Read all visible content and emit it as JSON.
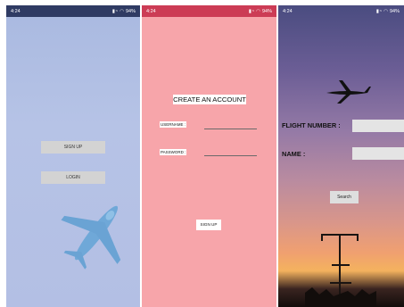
{
  "screens": [
    {
      "status": {
        "time": "4:24",
        "battery": "94%"
      },
      "buttons": {
        "signup": "SIGN UP",
        "login": "LOGIN"
      },
      "colors": {
        "background": "#b4c1e5",
        "status_bar": "#2f3b63",
        "button": "#d3d3d3"
      },
      "icons": [
        "photo-icon",
        "airplane-illustration"
      ]
    },
    {
      "status": {
        "time": "4:24",
        "battery": "94%"
      },
      "title": "CREATE AN ACCOUNT",
      "fields": {
        "username_label": "USERNAME :",
        "password_label": "PASSWORD :"
      },
      "button": "SIGN UP",
      "colors": {
        "background": "#f7a5aa",
        "status_bar": "#cc3c55"
      }
    },
    {
      "status": {
        "time": "4:24",
        "battery": "94%"
      },
      "fields": {
        "flight_number_label": "FLIGHT NUMBER :",
        "name_label": "NAME :"
      },
      "button": "Search",
      "colors": {
        "sky_top": "#4a4c80",
        "sky_bottom": "#f4b25e"
      },
      "icons": [
        "airplane-silhouette",
        "approach-lights"
      ]
    }
  ]
}
